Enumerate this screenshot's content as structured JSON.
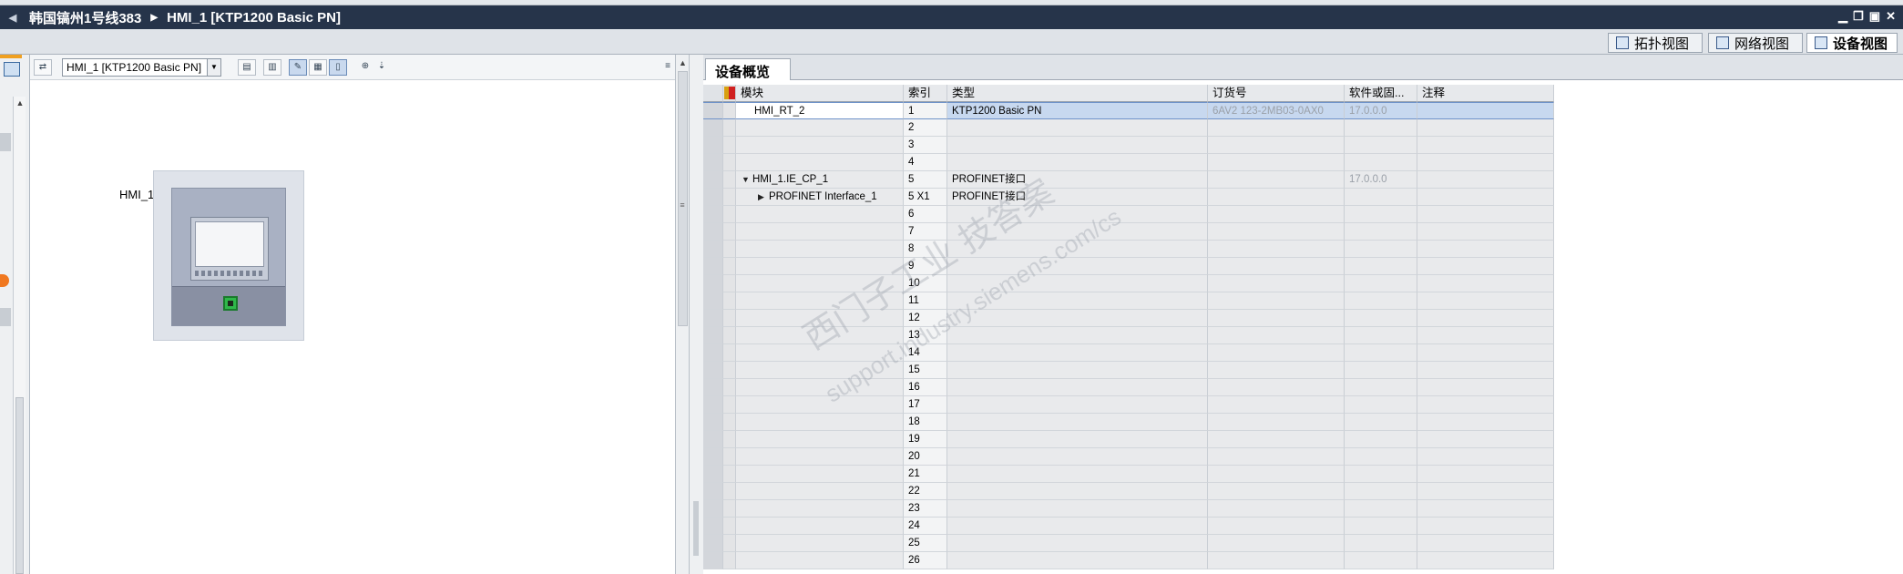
{
  "titlebar": {
    "crumbs": [
      "韩国镐州1号线383",
      "HMI_1 [KTP1200 Basic PN]"
    ]
  },
  "view_tabs": [
    {
      "label": "拓扑视图",
      "icon": "topology-icon"
    },
    {
      "label": "网络视图",
      "icon": "network-icon"
    },
    {
      "label": "设备视图",
      "icon": "device-icon",
      "active": true
    }
  ],
  "canvas": {
    "device_select": "HMI_1 [KTP1200 Basic PN]",
    "device_label": "HMI_1"
  },
  "overview": {
    "tab_label": "设备概览",
    "columns": [
      "模块",
      "索引",
      "类型",
      "订货号",
      "软件或固...",
      "注释"
    ],
    "rows": [
      {
        "module": "HMI_RT_2",
        "index": "1",
        "type": "KTP1200 Basic PN",
        "order": "6AV2 123-2MB03-0AX0",
        "fw": "17.0.0.0",
        "comment": "",
        "selected": true
      },
      {
        "module": "",
        "index": "2",
        "type": "",
        "order": "",
        "fw": "",
        "comment": ""
      },
      {
        "module": "",
        "index": "3",
        "type": "",
        "order": "",
        "fw": "",
        "comment": ""
      },
      {
        "module": "",
        "index": "4",
        "type": "",
        "order": "",
        "fw": "",
        "comment": ""
      },
      {
        "module": "HMI_1.IE_CP_1",
        "index": "5",
        "type": "PROFINET接口",
        "order": "",
        "fw": "17.0.0.0",
        "comment": "",
        "expander": "▼"
      },
      {
        "module": "PROFINET Interface_1",
        "index": "5 X1",
        "type": "PROFINET接口",
        "order": "",
        "fw": "",
        "comment": "",
        "expander": "▶",
        "indent": true
      },
      {
        "module": "",
        "index": "6",
        "type": "",
        "order": "",
        "fw": "",
        "comment": ""
      },
      {
        "module": "",
        "index": "7",
        "type": "",
        "order": "",
        "fw": "",
        "comment": ""
      },
      {
        "module": "",
        "index": "8",
        "type": "",
        "order": "",
        "fw": "",
        "comment": ""
      },
      {
        "module": "",
        "index": "9",
        "type": "",
        "order": "",
        "fw": "",
        "comment": ""
      },
      {
        "module": "",
        "index": "10",
        "type": "",
        "order": "",
        "fw": "",
        "comment": ""
      },
      {
        "module": "",
        "index": "11",
        "type": "",
        "order": "",
        "fw": "",
        "comment": ""
      },
      {
        "module": "",
        "index": "12",
        "type": "",
        "order": "",
        "fw": "",
        "comment": ""
      },
      {
        "module": "",
        "index": "13",
        "type": "",
        "order": "",
        "fw": "",
        "comment": ""
      },
      {
        "module": "",
        "index": "14",
        "type": "",
        "order": "",
        "fw": "",
        "comment": ""
      },
      {
        "module": "",
        "index": "15",
        "type": "",
        "order": "",
        "fw": "",
        "comment": ""
      },
      {
        "module": "",
        "index": "16",
        "type": "",
        "order": "",
        "fw": "",
        "comment": ""
      },
      {
        "module": "",
        "index": "17",
        "type": "",
        "order": "",
        "fw": "",
        "comment": ""
      },
      {
        "module": "",
        "index": "18",
        "type": "",
        "order": "",
        "fw": "",
        "comment": ""
      },
      {
        "module": "",
        "index": "19",
        "type": "",
        "order": "",
        "fw": "",
        "comment": ""
      },
      {
        "module": "",
        "index": "20",
        "type": "",
        "order": "",
        "fw": "",
        "comment": ""
      },
      {
        "module": "",
        "index": "21",
        "type": "",
        "order": "",
        "fw": "",
        "comment": ""
      },
      {
        "module": "",
        "index": "22",
        "type": "",
        "order": "",
        "fw": "",
        "comment": ""
      },
      {
        "module": "",
        "index": "23",
        "type": "",
        "order": "",
        "fw": "",
        "comment": ""
      },
      {
        "module": "",
        "index": "24",
        "type": "",
        "order": "",
        "fw": "",
        "comment": ""
      },
      {
        "module": "",
        "index": "25",
        "type": "",
        "order": "",
        "fw": "",
        "comment": ""
      },
      {
        "module": "",
        "index": "26",
        "type": "",
        "order": "",
        "fw": "",
        "comment": ""
      }
    ]
  },
  "watermark": {
    "line1": "西门子工业  技答案",
    "line2": "support.industry.siemens.com/cs"
  }
}
